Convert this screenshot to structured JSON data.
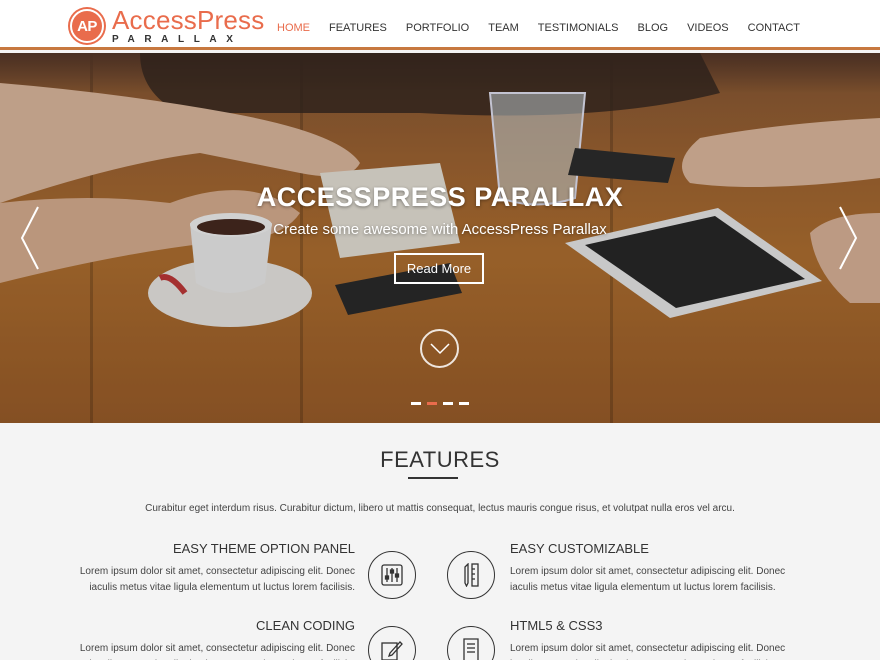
{
  "brand": {
    "badge": "AP",
    "name": "AccessPress",
    "tagline": "PARALLAX",
    "color": "#e96c4c"
  },
  "nav": {
    "items": [
      {
        "label": "HOME",
        "active": true
      },
      {
        "label": "FEATURES",
        "active": false
      },
      {
        "label": "PORTFOLIO",
        "active": false
      },
      {
        "label": "TEAM",
        "active": false
      },
      {
        "label": "TESTIMONIALS",
        "active": false
      },
      {
        "label": "BLOG",
        "active": false
      },
      {
        "label": "VIDEOS",
        "active": false
      },
      {
        "label": "CONTACT",
        "active": false
      }
    ]
  },
  "hero": {
    "title": "ACCESSPRESS PARALLAX",
    "subtitle": "Create some awesome with AccessPress Parallax",
    "button": "Read More",
    "slide_count": 4,
    "active_slide": 2,
    "icons": {
      "prev": "chevron-left-icon",
      "next": "chevron-right-icon",
      "scroll": "chevron-down-icon"
    }
  },
  "features": {
    "title": "FEATURES",
    "description": "Curabitur eget interdum risus. Curabitur dictum, libero ut mattis consequat, lectus mauris congue risus, et volutpat nulla eros vel arcu.",
    "items": [
      {
        "title": "EASY THEME OPTION PANEL",
        "text": "Lorem ipsum dolor sit amet, consectetur adipiscing elit. Donec iaculis metus vitae ligula elementum ut luctus lorem facilisis.",
        "icon": "sliders-icon"
      },
      {
        "title": "EASY CUSTOMIZABLE",
        "text": "Lorem ipsum dolor sit amet, consectetur adipiscing elit. Donec iaculis metus vitae ligula elementum ut luctus lorem facilisis.",
        "icon": "pencil-ruler-icon"
      },
      {
        "title": "CLEAN CODING",
        "text": "Lorem ipsum dolor sit amet, consectetur adipiscing elit. Donec iaculis metus vitae ligula elementum ut luctus lorem facilisis.",
        "icon": "edit-icon"
      },
      {
        "title": "HTML5 & CSS3",
        "text": "Lorem ipsum dolor sit amet, consectetur adipiscing elit. Donec iaculis metus vitae ligula elementum ut luctus lorem facilisis.",
        "icon": "document-icon"
      }
    ]
  }
}
